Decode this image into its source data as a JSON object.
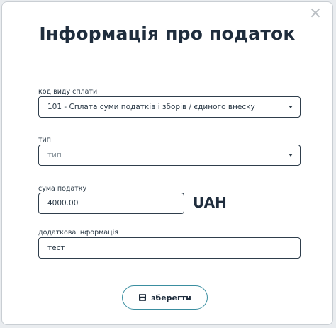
{
  "modal": {
    "title": "Інформація про податок",
    "close_glyph": "×"
  },
  "payment_type": {
    "label": "код виду сплати",
    "value": "101 - Сплата суми податків і зборів / єдиного внеску"
  },
  "type": {
    "label": "тип",
    "placeholder": "тип"
  },
  "tax_amount": {
    "label": "сума податку",
    "value": "4000.00",
    "currency": "UAH"
  },
  "additional_info": {
    "label": "додаткова інформація",
    "value": "тест"
  },
  "actions": {
    "save_label": "зберегти",
    "save_icon": "floppy-disk-icon"
  },
  "colors": {
    "accent": "#3a8ea0",
    "text": "#1f2d3d",
    "border": "#2f3e4c"
  }
}
